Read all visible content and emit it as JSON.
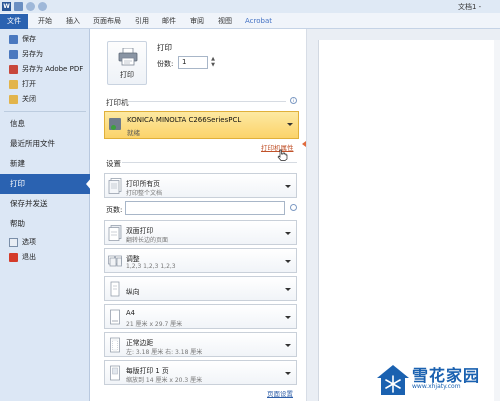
{
  "app": {
    "title_bar": {
      "doc_title": "文档1 -"
    },
    "tabs": [
      "文件",
      "开始",
      "插入",
      "页面布局",
      "引用",
      "邮件",
      "审阅",
      "视图",
      "Acrobat"
    ]
  },
  "nav": {
    "save": "保存",
    "save_as": "另存为",
    "save_as_pdf": "另存为 Adobe PDF",
    "open": "打开",
    "close": "关闭",
    "info": "信息",
    "recent": "最近所用文件",
    "new": "新建",
    "print": "打印",
    "save_send": "保存并发送",
    "help": "帮助",
    "options": "选项",
    "exit": "退出"
  },
  "print": {
    "button_label": "打印",
    "heading": "打印",
    "copies_label": "份数:",
    "copies_value": "1"
  },
  "printer": {
    "section_title": "打印机",
    "name": "KONICA MINOLTA C266SeriesPCL",
    "status": "就绪",
    "properties_link": "打印机属性"
  },
  "settings": {
    "section_title": "设置",
    "pages_label": "页数:",
    "items": [
      {
        "main": "打印所有页",
        "sub": "打印整个文档"
      },
      {
        "main": "双面打印",
        "sub": "翻转长边的页面"
      },
      {
        "main": "调整",
        "sub": "1,2,3     1,2,3     1,2,3"
      },
      {
        "main": "纵向",
        "sub": ""
      },
      {
        "main": "A4",
        "sub": "21 厘米 x 29.7 厘米"
      },
      {
        "main": "正常边距",
        "sub": "左:  3.18 厘米    右:  3.18 厘米"
      },
      {
        "main": "每版打印 1 页",
        "sub": "缩放到 14 厘米 x 20.3 厘米"
      }
    ],
    "page_setup_link": "页面设置"
  },
  "watermark": {
    "name": "雪花家园",
    "url": "www.xhjaty.com"
  },
  "colors": {
    "accent": "#2a62b1",
    "printer_highlight": "#fbd36a",
    "arrow": "#e06a3c"
  }
}
